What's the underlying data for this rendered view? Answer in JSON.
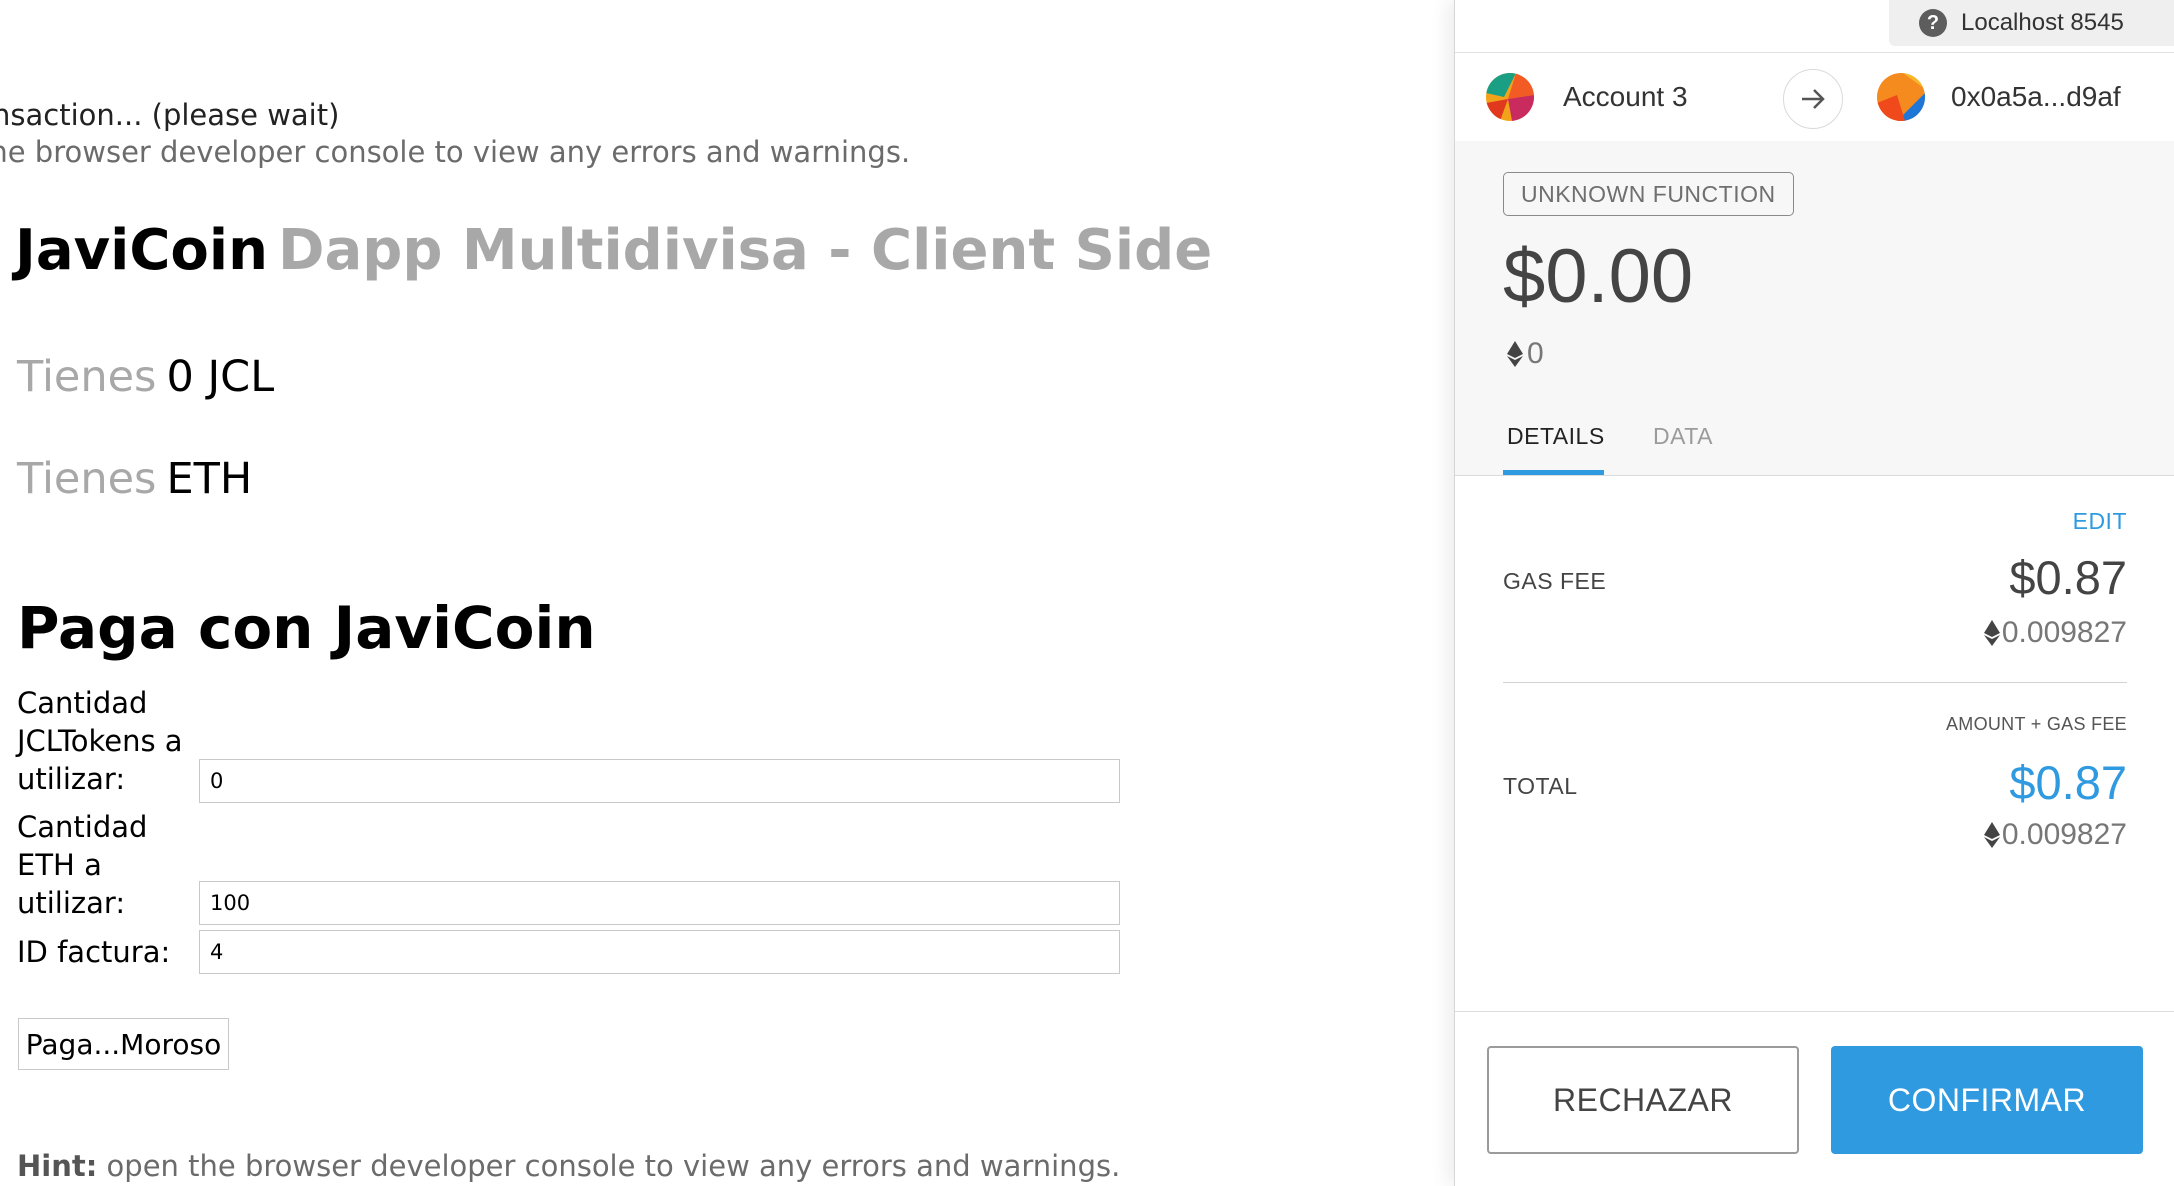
{
  "dapp": {
    "status_text": "nsaction... (please wait)",
    "hint_top": "the browser developer console to view any errors and warnings.",
    "title_brand": "JaviCoin",
    "title_sub": "Dapp Multidivisa - Client Side",
    "balance_label": "Tienes",
    "jcl_balance": "0 JCL",
    "eth_balance": "ETH",
    "pay_heading": "Paga con JaviCoin",
    "form": {
      "jcl_label": "Cantidad JCLTokens a utilizar:",
      "jcl_value": "0",
      "eth_label": "Cantidad ETH a utilizar:",
      "eth_value": "100",
      "id_label": "ID factura:",
      "id_value": "4"
    },
    "pay_button": "Paga...Moroso",
    "hint_bottom_bold": "Hint:",
    "hint_bottom_text": " open the browser developer console to view any errors and warnings."
  },
  "metamask": {
    "network": "Localhost 8545",
    "from_account": "Account 3",
    "to_address": "0x0a5a...d9af",
    "function_badge": "UNKNOWN FUNCTION",
    "fiat_total": "$0.00",
    "eth_total": "0",
    "tabs": {
      "details": "DETAILS",
      "data": "DATA"
    },
    "edit": "EDIT",
    "gas_fee_label": "GAS FEE",
    "gas_fee_fiat": "$0.87",
    "gas_fee_eth": "0.009827",
    "amount_gas_label": "AMOUNT + GAS FEE",
    "total_label": "TOTAL",
    "total_fiat": "$0.87",
    "total_eth": "0.009827",
    "reject_button": "RECHAZAR",
    "confirm_button": "CONFIRMAR",
    "accent_color": "#2f9ae0"
  }
}
